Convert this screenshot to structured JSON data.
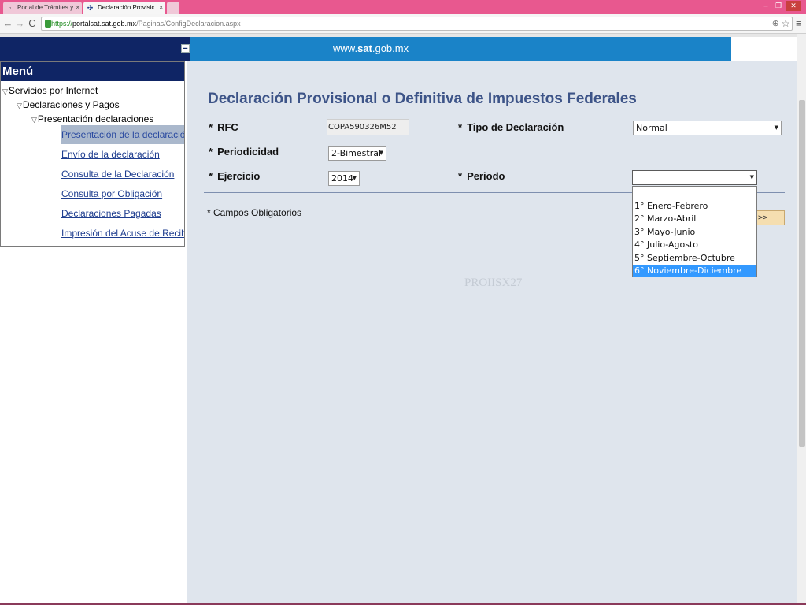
{
  "browser": {
    "tabs": [
      {
        "label": "Portal de Trámites y Servi",
        "favicon": "page-icon"
      },
      {
        "label": "Declaración Provisional o",
        "favicon": "sat-logo-icon"
      }
    ],
    "close_glyph": "×",
    "url": {
      "scheme": "https://",
      "host": "portalsat.sat.gob.mx",
      "path": "/Paginas/ConfigDeclaracion.aspx"
    },
    "back_glyph": "←",
    "forward_glyph": "→",
    "reload_glyph": "C",
    "menu_glyph": "≡",
    "star_glyph": "☆",
    "zoom_glyph": "⊕",
    "window_buttons": {
      "minimize": "–",
      "restore": "❐",
      "close": "✕"
    },
    "colors": {
      "titlebar": "#e8588f"
    }
  },
  "header": {
    "logo_prefix": "www.",
    "logo_brand": "sat",
    "logo_suffix": ".gob.mx",
    "collapse_label": "−",
    "colors": {
      "left": "#0f2565",
      "right": "#1a83c8"
    }
  },
  "menu": {
    "title": "Menú",
    "tree": [
      {
        "label": "Servicios por Internet"
      },
      {
        "label": "Declaraciones y Pagos"
      },
      {
        "label": "Presentación declaraciones"
      }
    ],
    "expand_glyph": "▽",
    "links": [
      {
        "label": "Presentación de la declaración",
        "selected": true
      },
      {
        "label": "Envío de la declaración"
      },
      {
        "label": "Consulta de la Declaración"
      },
      {
        "label": "Consulta por Obligación"
      },
      {
        "label": "Declaraciones Pagadas"
      },
      {
        "label": "Impresión del Acuse de Recibo"
      }
    ]
  },
  "form": {
    "title": "Declaración Provisional o Definitiva de Impuestos Federales",
    "required_marker": "*",
    "fields": {
      "rfc": {
        "label": "RFC",
        "value": "COPA590326M52"
      },
      "periodicidad": {
        "label": "Periodicidad",
        "value": "2-Bimestral"
      },
      "ejercicio": {
        "label": "Ejercicio",
        "value": "2014"
      },
      "tipo": {
        "label": "Tipo de Declaración",
        "value": "Normal"
      },
      "periodo": {
        "label": "Periodo",
        "value": ""
      }
    },
    "select_arrow": "▼",
    "required_note": "* Campos Obligatorios",
    "next_label": ">>",
    "periodo_options": [
      {
        "label": "1° Enero-Febrero"
      },
      {
        "label": "2° Marzo-Abril"
      },
      {
        "label": "3° Mayo-Junio"
      },
      {
        "label": "4° Julio-Agosto"
      },
      {
        "label": "5° Septiembre-Octubre"
      },
      {
        "label": "6° Noviembre-Diciembre",
        "highlighted": true
      }
    ],
    "watermark": "PROIISX27"
  }
}
